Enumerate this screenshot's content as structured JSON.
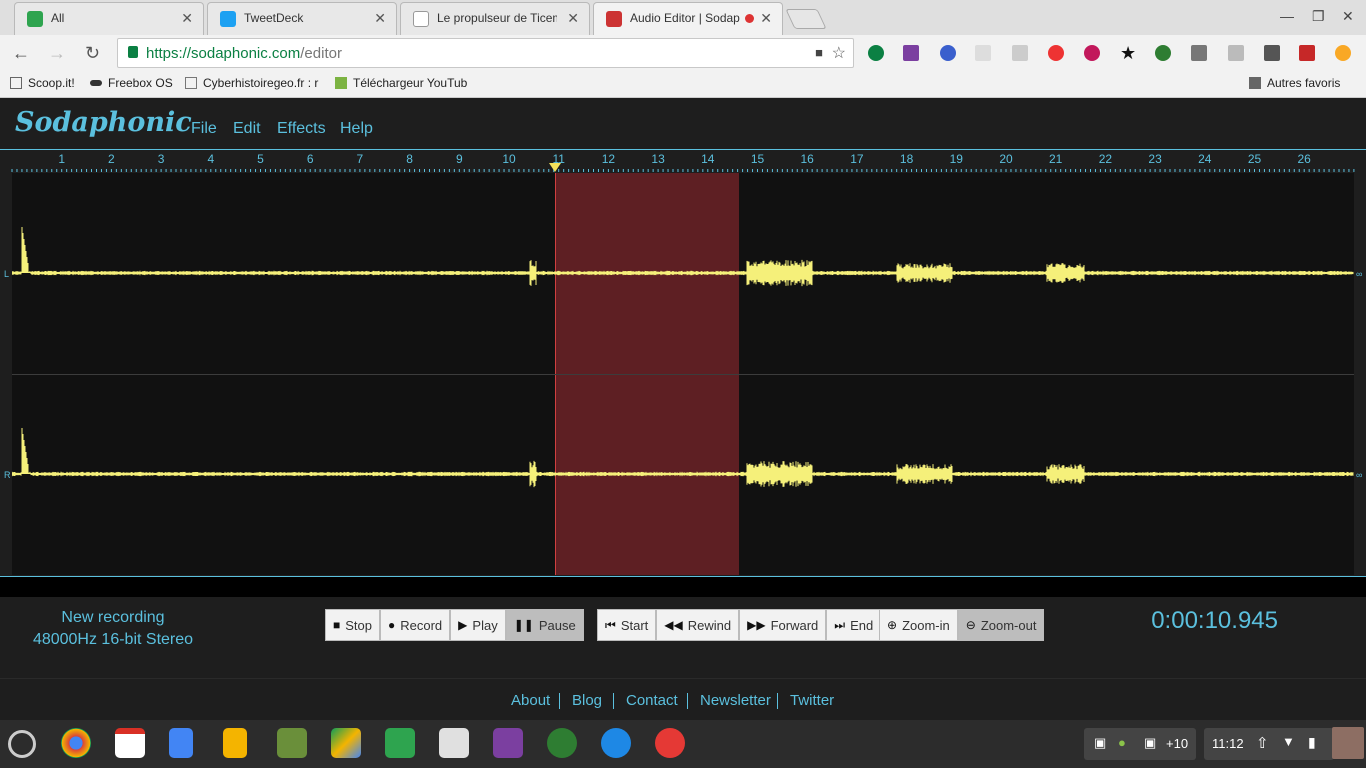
{
  "browser": {
    "tabs": [
      {
        "title": "All",
        "favicon_color": "#2ea44f"
      },
      {
        "title": "TweetDeck",
        "favicon_color": "#1da1f2"
      },
      {
        "title": "Le propulseur de Ticem",
        "favicon_color": "#bbbbbb"
      },
      {
        "title": "Audio Editor | Sodap",
        "favicon_color": "#cc3333"
      }
    ],
    "url_host": "https://sodaphonic.com",
    "url_path": "/editor",
    "bookmarks": [
      "Scoop.it!",
      "Freebox OS",
      "Cyberhistoiregeo.fr : r",
      "Téléchargeur YouTub",
      "Autres favoris"
    ]
  },
  "app": {
    "logo": "Sodaphonic",
    "menu": [
      "File",
      "Edit",
      "Effects",
      "Help"
    ],
    "ruler_labels": [
      "1",
      "2",
      "3",
      "4",
      "5",
      "6",
      "7",
      "8",
      "9",
      "10",
      "11",
      "12",
      "13",
      "14",
      "15",
      "16",
      "17",
      "18",
      "19",
      "20",
      "21",
      "22",
      "23",
      "24",
      "25",
      "26"
    ],
    "channel_left": "L",
    "channel_right": "R",
    "channel_end": "∞",
    "recording_name": "New recording",
    "recording_format": "48000Hz 16-bit Stereo",
    "transport": {
      "stop": "Stop",
      "record": "Record",
      "play": "Play",
      "pause": "Pause"
    },
    "navigation": {
      "start": "Start",
      "rewind": "Rewind",
      "forward": "Forward",
      "end": "End"
    },
    "zoom": {
      "zoom_in": "Zoom-in",
      "zoom_out": "Zoom-out"
    },
    "timer": "0:00:10.945",
    "footer_links": [
      "About",
      "Blog",
      "Contact",
      "Newsletter",
      "Twitter"
    ],
    "colors": {
      "accent": "#5bc0de",
      "waveform": "#f5f07a",
      "selection": "#5e1f23"
    }
  },
  "shelf": {
    "overflow_count": "+10",
    "clock": "11:12"
  }
}
